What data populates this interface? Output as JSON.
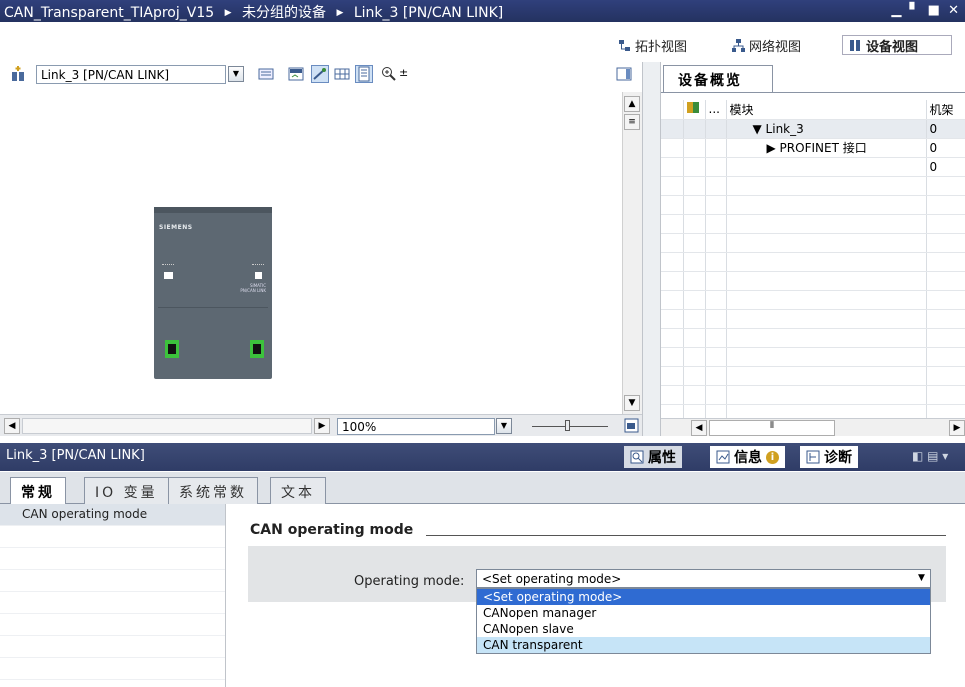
{
  "title_bar": {
    "crumbs": [
      "CAN_Transparent_TIAproj_V15",
      "未分组的设备",
      "Link_3 [PN/CAN LINK]"
    ],
    "separator": "▶"
  },
  "view_tabs": {
    "topology": "拓扑视图",
    "network": "网络视图",
    "device": "设备视图"
  },
  "device_toolbar": {
    "device_select": "Link_3 [PN/CAN LINK]"
  },
  "device_graphic": {
    "brand": "SIEMENS",
    "product_line1": "SIMATIC",
    "product_line2": "PN/CAN LINK"
  },
  "zoom": {
    "value": "100%"
  },
  "device_overview": {
    "tab_label": "设备概览",
    "columns": [
      "",
      "...",
      "模块",
      "机架"
    ],
    "rows": [
      {
        "module": "▼ Link_3",
        "rack": "0",
        "indent": 1
      },
      {
        "module": "▶ PROFINET 接口",
        "rack": "0",
        "indent": 2
      },
      {
        "module": "",
        "rack": "0",
        "indent": 0
      }
    ]
  },
  "properties": {
    "title": "Link_3 [PN/CAN LINK]",
    "tabs": {
      "properties": "属性",
      "info": "信息",
      "diagnostics": "诊断"
    },
    "sub_tabs": [
      "常规",
      "IO 变量",
      "系统常数",
      "文本"
    ],
    "nav_items": [
      "CAN operating mode"
    ],
    "section_title": "CAN operating mode",
    "field_label": "Operating mode:",
    "field_value": "<Set operating mode>",
    "options": [
      "<Set operating mode>",
      "CANopen manager",
      "CANopen slave",
      "CAN transparent"
    ]
  },
  "colors": {
    "title_bar": "#2a3868",
    "selection": "#2f6bd2",
    "hover": "#c6e4f7",
    "port_green": "#3cc23c"
  }
}
